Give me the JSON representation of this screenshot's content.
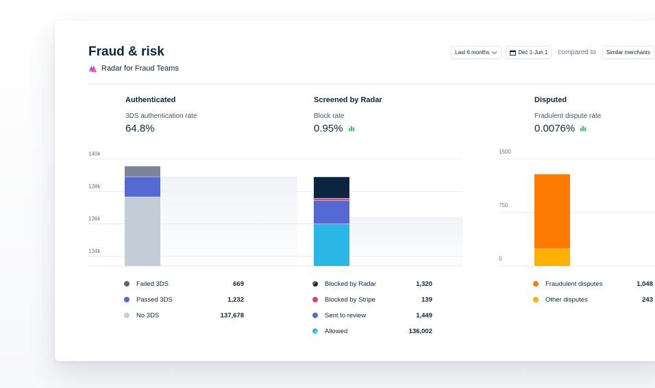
{
  "header": {
    "title": "Fraud & risk",
    "subtitle": "Radar for Fraud Teams"
  },
  "controls": {
    "range_label": "Last 6 months",
    "date_label": "Dec 1-Jun 1",
    "compare_label": "compared to",
    "compare_target": "Similar merchants"
  },
  "columns": [
    {
      "title": "Authenticated",
      "metric_label": "3DS authentication rate",
      "metric_value": "64.8%",
      "has_trend_icon": false,
      "legend": [
        {
          "label": "Failed 3DS",
          "value": "669",
          "color": "#5b6472"
        },
        {
          "label": "Passed 3DS",
          "value": "1,232",
          "color": "#5469d4"
        },
        {
          "label": "No 3DS",
          "value": "137,678",
          "color": "#c4ccd8"
        }
      ]
    },
    {
      "title": "Screened by Radar",
      "metric_label": "Block rate",
      "metric_value": "0.95%",
      "has_trend_icon": true,
      "legend": [
        {
          "label": "Blocked by Radar",
          "value": "1,320",
          "color": "#0a2540"
        },
        {
          "label": "Blocked by Stripe",
          "value": "139",
          "color": "#d04a72"
        },
        {
          "label": "Sent to review",
          "value": "1,449",
          "color": "#5469d4"
        },
        {
          "label": "Allowed",
          "value": "136,002",
          "color": "#2bb6e8"
        }
      ]
    },
    {
      "title": "Disputed",
      "metric_label": "Fradulent dispute rate",
      "metric_value": "0.0076%",
      "has_trend_icon": true,
      "legend": [
        {
          "label": "Fraudulent disputes",
          "value": "1,048",
          "color": "#ff7a00"
        },
        {
          "label": "Other disputes",
          "value": "243",
          "color": "#ffb000"
        }
      ]
    }
  ],
  "chart_data": [
    {
      "type": "bar",
      "stacked": true,
      "ylim": [
        133400,
        140000
      ],
      "yticks": [
        "140k",
        "138k",
        "136k",
        "134k"
      ],
      "series": [
        {
          "name": "No 3DS",
          "values": [
            137678
          ],
          "color": "#c4ccd8"
        },
        {
          "name": "Passed 3DS",
          "values": [
            1232
          ],
          "color": "#5469d4"
        },
        {
          "name": "Failed 3DS",
          "values": [
            669
          ],
          "color": "#7b8597"
        }
      ]
    },
    {
      "type": "bar",
      "stacked": true,
      "ylim": [
        133400,
        140000
      ],
      "series": [
        {
          "name": "Allowed",
          "values": [
            136002
          ],
          "color": "#2bb6e8"
        },
        {
          "name": "Sent to review",
          "values": [
            1449
          ],
          "color": "#5469d4"
        },
        {
          "name": "Blocked by Stripe",
          "values": [
            139
          ],
          "color": "#d04a72"
        },
        {
          "name": "Blocked by Radar",
          "values": [
            1320
          ],
          "color": "#0a2540"
        }
      ]
    },
    {
      "type": "bar",
      "stacked": true,
      "ylim": [
        0,
        1500
      ],
      "yticks": [
        "1500",
        "750",
        "0"
      ],
      "series": [
        {
          "name": "Other disputes",
          "values": [
            243
          ],
          "color": "#ffb000"
        },
        {
          "name": "Fraudulent disputes",
          "values": [
            1048
          ],
          "color": "#ff7a00"
        }
      ]
    }
  ]
}
